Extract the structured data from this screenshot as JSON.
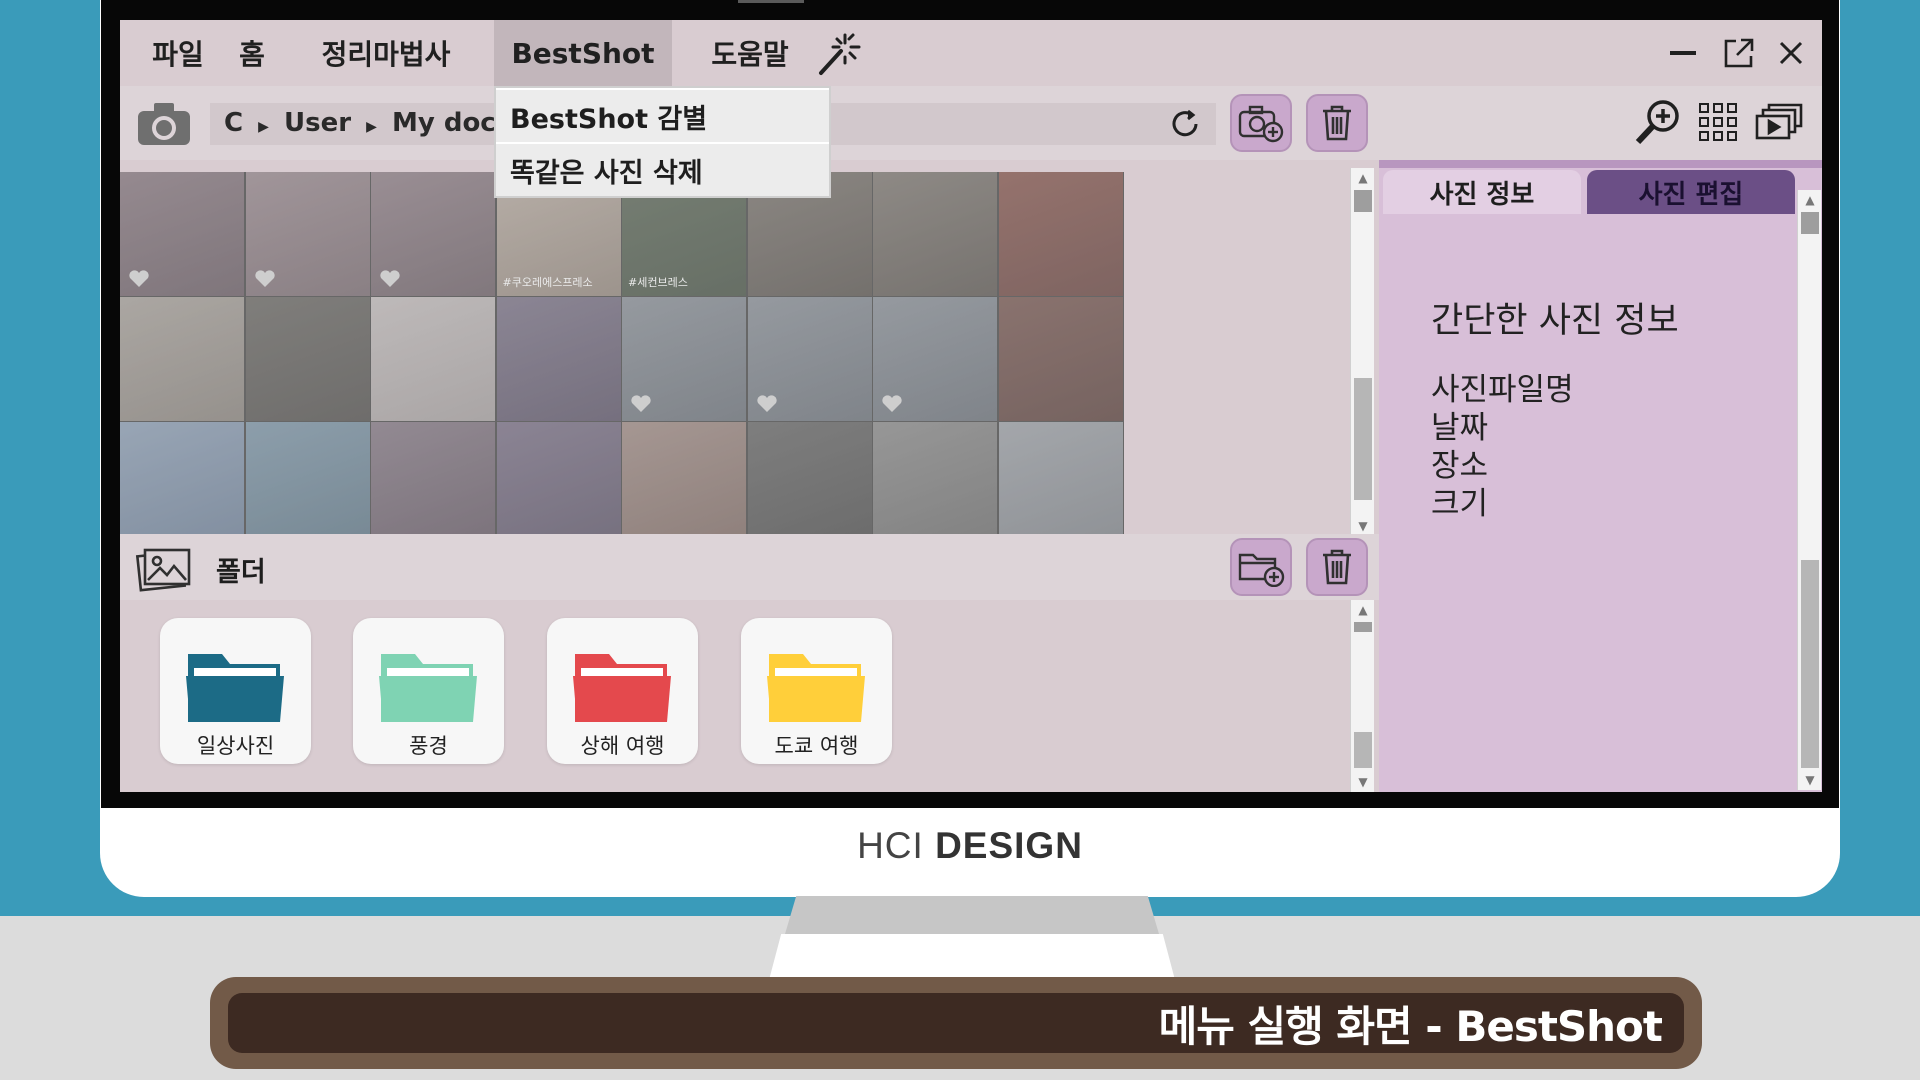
{
  "menu": {
    "items": [
      {
        "label": "파일"
      },
      {
        "label": "홈"
      },
      {
        "label": "정리마법사"
      },
      {
        "label": "BestShot"
      },
      {
        "label": "도움말"
      }
    ],
    "active": "BestShot",
    "wand_icon": "magic-wand-icon"
  },
  "dropdown": {
    "items": [
      {
        "label": "BestShot 감별"
      },
      {
        "label": "똑같은 사진 삭제"
      }
    ]
  },
  "toolbar": {
    "path": [
      "C",
      "User",
      "My documer"
    ],
    "camera_icon": "camera-icon",
    "refresh_icon": "refresh-icon",
    "add_photo_icon": "add-photo-icon",
    "delete_icon": "trash-icon",
    "zoom_icon": "zoom-in-icon",
    "grid_icon": "grid-view-icon",
    "slideshow_icon": "slideshow-icon"
  },
  "folders": {
    "title": "폴더",
    "items": [
      {
        "label": "일상사진",
        "color": "#1c6b86"
      },
      {
        "label": "풍경",
        "color": "#7fd3b3"
      },
      {
        "label": "상해 여행",
        "color": "#e4494d"
      },
      {
        "label": "도쿄 여행",
        "color": "#ffcf3a"
      }
    ]
  },
  "right_panel": {
    "tabs": [
      {
        "label": "사진 정보",
        "active": true
      },
      {
        "label": "사진 편집",
        "active": false
      }
    ],
    "title": "간단한 사진 정보",
    "fields": [
      "사진파일명",
      "날짜",
      "장소",
      "크기"
    ]
  },
  "branding": {
    "prefix": "HCI",
    "word": "DESIGN"
  },
  "caption": "메뉴 실행 화면 - BestShot",
  "colors": {
    "accent_button": "#c9a8cc",
    "panel": "#d8bfd8",
    "tab_active": "#d8bfd8",
    "tab_inactive": "#6b4f86",
    "app_bg": "#d9ccd1",
    "wall": "#3a9bba"
  },
  "photos": {
    "grid_rows": 3,
    "grid_cols": 8,
    "captions": [
      "#쿠오레에스프레소",
      "#세컨브레스"
    ]
  }
}
